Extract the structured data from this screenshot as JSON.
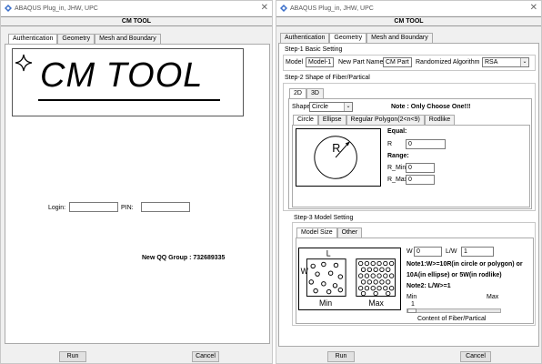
{
  "left": {
    "window_title": "ABAQUS Plug_in, JHW, UPC",
    "toolbox_title": "CM TOOL",
    "tabs": [
      "Authentication",
      "Geometry",
      "Mesh and Boundary"
    ],
    "logo_text": "CM TOOL",
    "login_label": "Login:",
    "login_value": "",
    "pin_label": "PIN:",
    "pin_value": "",
    "qq_group": "New QQ Group : 732689335",
    "run_label": "Run",
    "cancel_label": "Cancel"
  },
  "right": {
    "window_title": "ABAQUS Plug_in, JHW, UPC",
    "toolbox_title": "CM TOOL",
    "tabs": [
      "Authentication",
      "Geometry",
      "Mesh and Boundary"
    ],
    "step1": {
      "title": "Step-1 Basic Setting",
      "model_label": "Model",
      "model_value": "Model-1",
      "part_label": "New Part Name",
      "part_value": "CM Part",
      "algo_label": "Randomized Algorithm",
      "algo_value": "RSA"
    },
    "step2": {
      "title": "Step-2 Shape of Fiber/Partical",
      "dim_tabs": [
        "2D",
        "3D"
      ],
      "shape_label": "Shape",
      "shape_value": "Circle",
      "note": "Note : Only Choose One!!!",
      "shape_tabs": [
        "Circle",
        "Ellipse",
        "Regular Polygon(2<n<9)",
        "Rodlike"
      ],
      "diagram_letter": "R",
      "equal_label": "Equal:",
      "r_label": "R",
      "r_value": "0",
      "range_label": "Range:",
      "rmin_label": "R_Min",
      "rmin_value": "0",
      "rmax_label": "R_Max",
      "rmax_value": "0"
    },
    "step3": {
      "title": "Step-3 Model Setting",
      "tabs": [
        "Model Size",
        "Other"
      ],
      "diagram_l": "L",
      "diagram_w": "W",
      "diagram_min": "Min",
      "diagram_max": "Max",
      "w_label": "W",
      "w_value": "0",
      "lw_label": "L/W",
      "lw_value": "1",
      "note1a": "Note1:W>=10R(in circle or polygon) or",
      "note1b": "10A(in ellipse) or 5W(in rodlike)",
      "note2": "Note2: L/W>=1",
      "slider_min": "Min",
      "slider_max": "Max",
      "slider_value": "1",
      "slider_fraction": 0.0,
      "slider_caption": "Content of Fiber/Partical"
    },
    "run_label": "Run",
    "cancel_label": "Cancel"
  }
}
